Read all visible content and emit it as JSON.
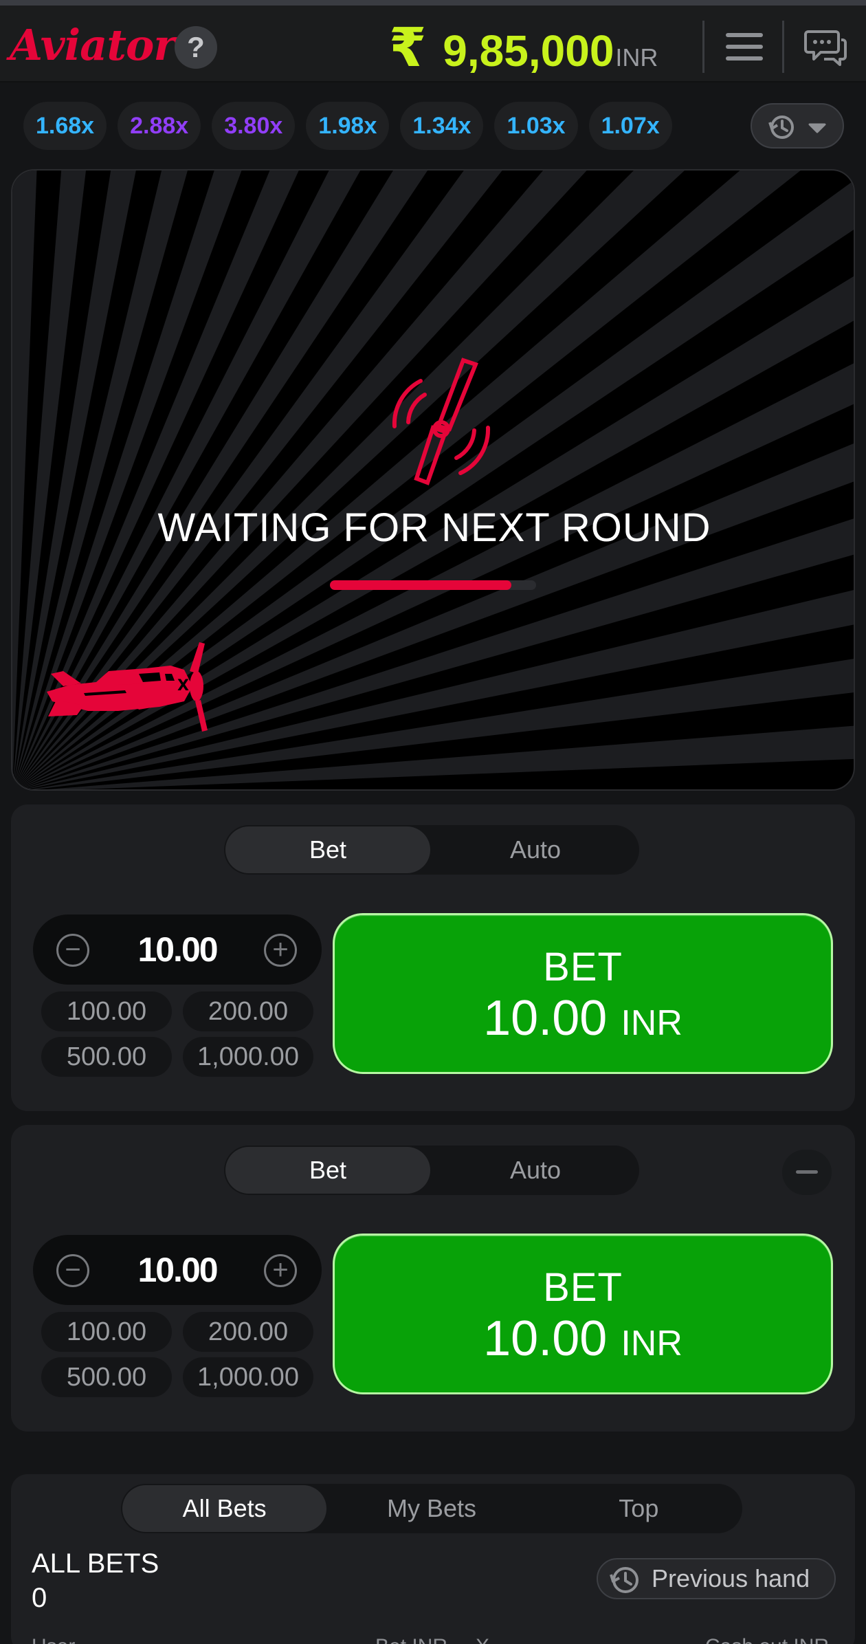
{
  "header": {
    "logo": "Aviator",
    "help_icon": "?",
    "balance_icon": "₹",
    "balance": "9,85,000",
    "currency": "INR"
  },
  "history": [
    {
      "value": "1.68x",
      "color": "#34b4ff"
    },
    {
      "value": "2.88x",
      "color": "#913ef8"
    },
    {
      "value": "3.80x",
      "color": "#913ef8"
    },
    {
      "value": "1.98x",
      "color": "#34b4ff"
    },
    {
      "value": "1.34x",
      "color": "#34b4ff"
    },
    {
      "value": "1.03x",
      "color": "#34b4ff"
    },
    {
      "value": "1.07x",
      "color": "#34b4ff"
    }
  ],
  "game": {
    "status": "WAITING FOR NEXT ROUND",
    "progress": 0.88,
    "accent": "#e50539"
  },
  "panel1": {
    "tabs": [
      "Bet",
      "Auto"
    ],
    "active_tab": "Bet",
    "amount": "10.00",
    "quick": [
      "100.00",
      "200.00",
      "500.00",
      "1,000.00"
    ],
    "bet_label": "BET",
    "bet_amount": "10.00",
    "bet_currency": "INR"
  },
  "panel2": {
    "tabs": [
      "Bet",
      "Auto"
    ],
    "active_tab": "Bet",
    "amount": "10.00",
    "quick": [
      "100.00",
      "200.00",
      "500.00",
      "1,000.00"
    ],
    "bet_label": "BET",
    "bet_amount": "10.00",
    "bet_currency": "INR"
  },
  "bets": {
    "tabs": [
      "All Bets",
      "My Bets",
      "Top"
    ],
    "active_tab": "All Bets",
    "title": "ALL BETS",
    "count": "0",
    "previous_hand": "Previous hand",
    "columns": [
      "User",
      "Bet INR",
      "X",
      "Cash out INR"
    ]
  },
  "colors": {
    "brand_red": "#e50539",
    "balance_green": "#c8f21c",
    "bet_green": "#08a208"
  }
}
